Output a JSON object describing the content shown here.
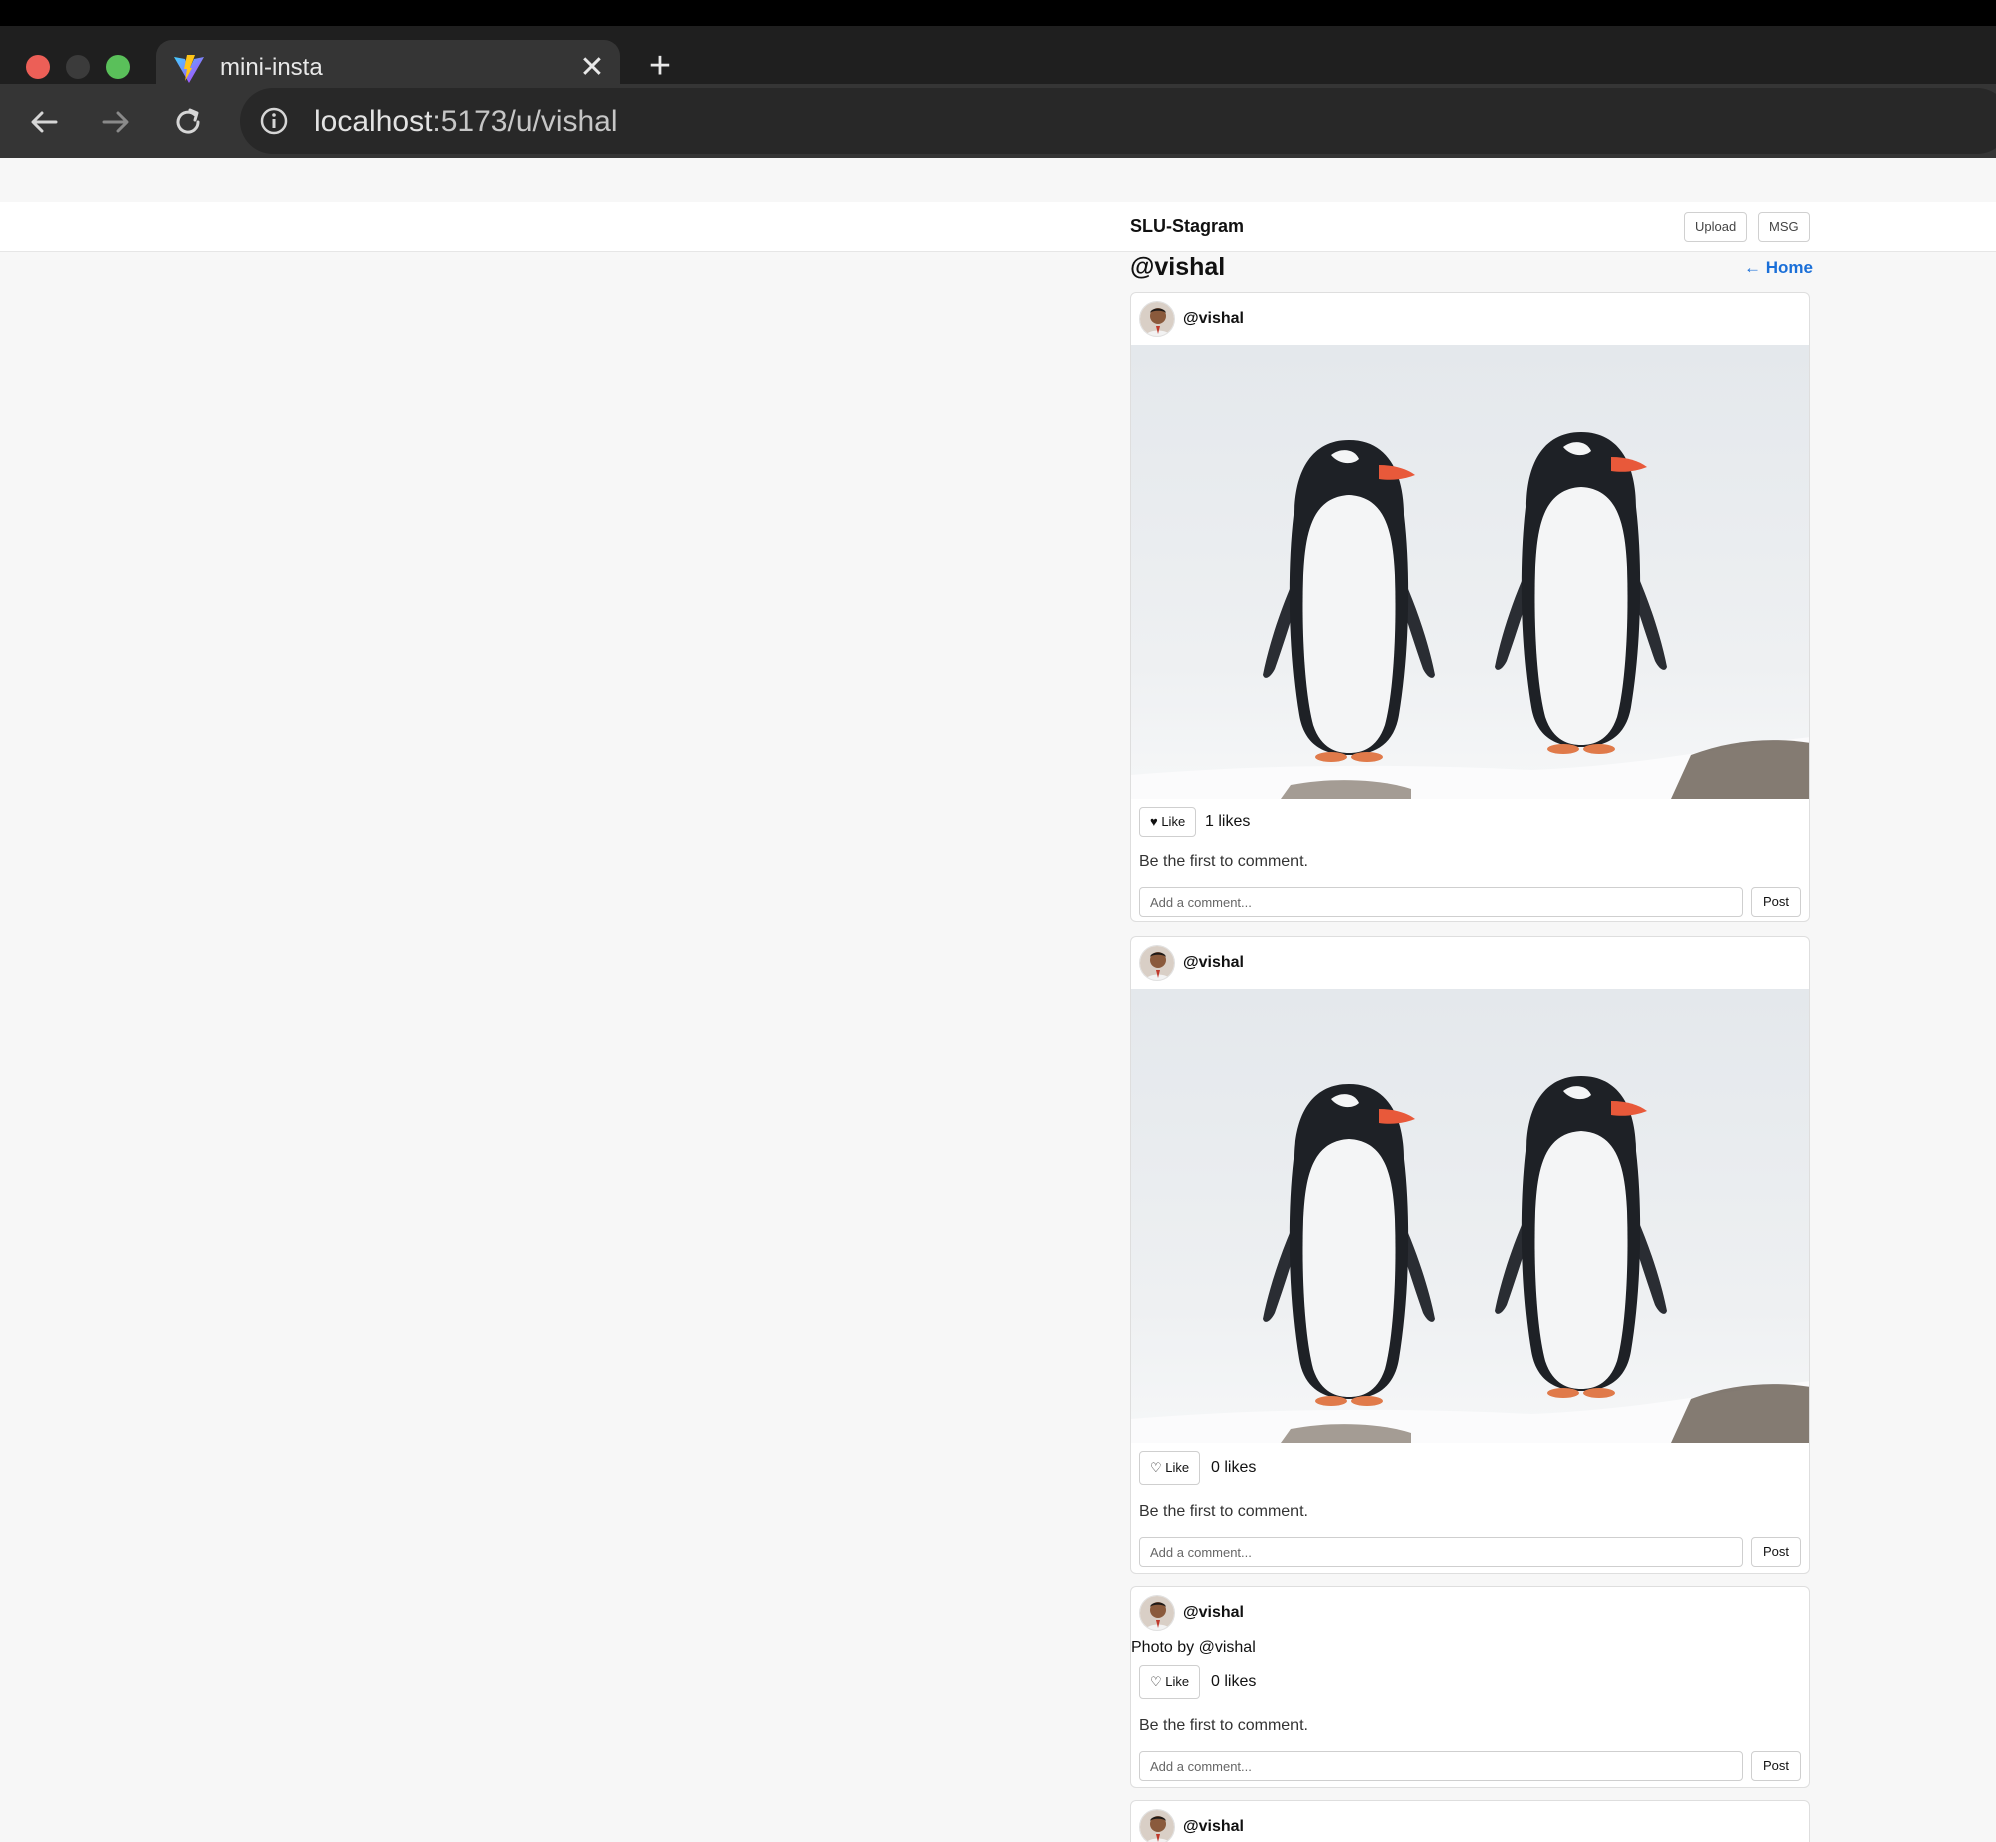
{
  "browser": {
    "tab_title": "mini-insta",
    "close_glyph": "✕",
    "new_tab_glyph": "+",
    "url_host": "localhost",
    "url_path": ":5173/u/vishal"
  },
  "app": {
    "brand": "SLU-Stagram",
    "upload_label": "Upload",
    "msg_label": "MSG"
  },
  "profile": {
    "title": "@vishal",
    "home_link": "← Home"
  },
  "posts": [
    {
      "username": "@vishal",
      "like_label": "♥ Like",
      "likes_text": "1 likes",
      "liked": true,
      "empty_comments": "Be the first to comment.",
      "comment_placeholder": "Add a comment...",
      "post_label": "Post",
      "image": "penguins"
    },
    {
      "username": "@vishal",
      "like_label": "♡ Like",
      "likes_text": "0 likes",
      "liked": false,
      "empty_comments": "Be the first to comment.",
      "comment_placeholder": "Add a comment...",
      "post_label": "Post",
      "image": "penguins"
    },
    {
      "username": "@vishal",
      "image_alt": "Photo by @vishal",
      "like_label": "♡ Like",
      "likes_text": "0 likes",
      "liked": false,
      "empty_comments": "Be the first to comment.",
      "comment_placeholder": "Add a comment...",
      "post_label": "Post",
      "image": "broken"
    },
    {
      "username": "@vishal"
    }
  ],
  "icons": {
    "back": "arrow-left-icon",
    "forward": "arrow-right-icon",
    "reload": "reload-icon",
    "info": "info-icon",
    "favicon": "vite-logo-icon"
  },
  "colors": {
    "link": "#1a6fd8",
    "page_bg": "#f7f7f7",
    "chrome_dark": "#1f1f1f",
    "chrome_tab": "#353535"
  }
}
